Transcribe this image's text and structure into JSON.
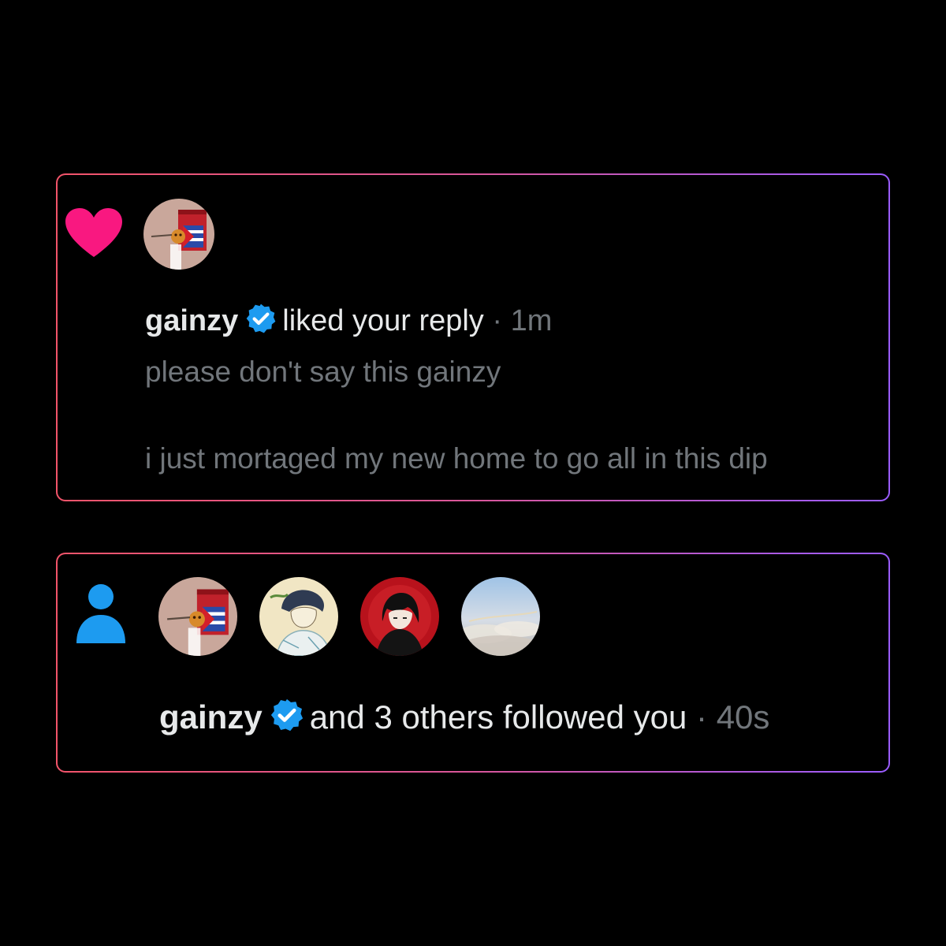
{
  "colors": {
    "heart": "#f91880",
    "follow": "#1d9bf0",
    "verified": "#1d9bf0",
    "border_start": "#f2546a",
    "border_end": "#9a5cff",
    "name_text": "#e7e9ea",
    "muted_text": "#71767b"
  },
  "notifications": [
    {
      "type": "like",
      "icon": "heart-icon",
      "user": "gainzy",
      "verified": true,
      "action": "liked your reply",
      "separator": "·",
      "time": "1m",
      "reply_lines": [
        "please don't say this gainzy",
        "i just mortaged my new home to go all in this dip"
      ]
    },
    {
      "type": "follow",
      "icon": "person-icon",
      "user": "gainzy",
      "verified": true,
      "action": "and 3 others followed you",
      "separator": "·",
      "time": "40s"
    }
  ]
}
